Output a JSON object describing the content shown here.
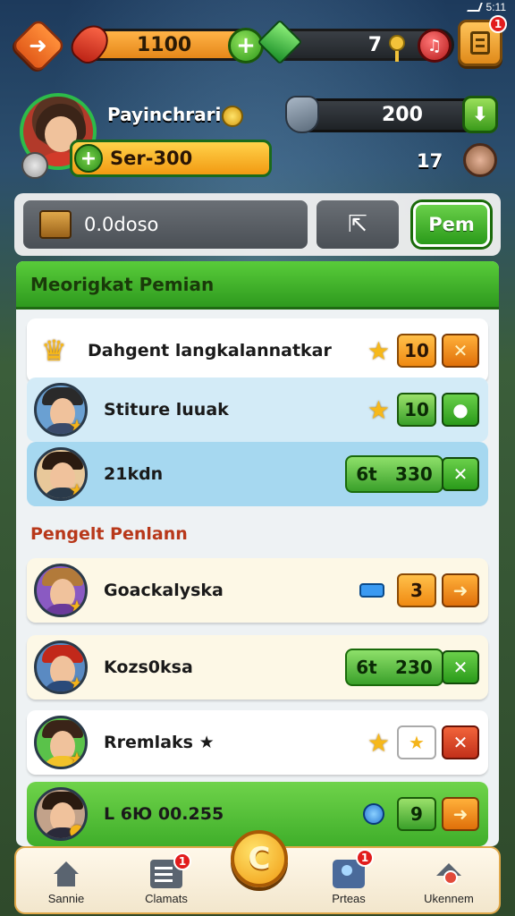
{
  "status": {
    "time": "5:11"
  },
  "top_bar": {
    "energy_value": "1100",
    "gems_value": "7",
    "menu_badge": "1",
    "back_glyph": "➜",
    "plus_glyph": "+",
    "music_glyph": "♫"
  },
  "profile": {
    "name": "Payinchrari",
    "xp_label": "Ser-300",
    "coins_value": "200",
    "small_count": "17",
    "arrow_glyph": "⬇"
  },
  "search": {
    "value": "0.0doso",
    "grid_glyph": "⇱",
    "action_label": "Pem"
  },
  "panel": {
    "header": "Meorigkat Pemian",
    "section_title": "Pengelt Penlann",
    "rows": [
      {
        "name": "Dahgent langkalannatkar",
        "value": "10",
        "action": "✕"
      },
      {
        "name": "Stiture luuak",
        "value": "10",
        "action": "●"
      },
      {
        "name": "21kdn",
        "score_prefix": "6t",
        "score": "330",
        "action": "✕"
      },
      {
        "name": "Goackalyska",
        "value": "3",
        "action": "➜"
      },
      {
        "name": "Kozs0ksa",
        "score_prefix": "6t",
        "score": "230",
        "action": "✕"
      },
      {
        "name": "Rremlaks ★",
        "value": "★",
        "action": "✕"
      },
      {
        "name": "L 6Ю 00.255",
        "value": "9",
        "action": "➜"
      }
    ]
  },
  "nav": {
    "items": [
      {
        "label": "Sannie",
        "badge": ""
      },
      {
        "label": "Clamats",
        "badge": "1"
      },
      {
        "label": "Prteas",
        "badge": "1"
      },
      {
        "label": "Ukennem",
        "badge": ""
      }
    ],
    "center_glyph": "C"
  },
  "colors": {
    "primary_green": "#3fae2a",
    "accent_orange": "#f08a12",
    "badge_red": "#e21c1c"
  }
}
